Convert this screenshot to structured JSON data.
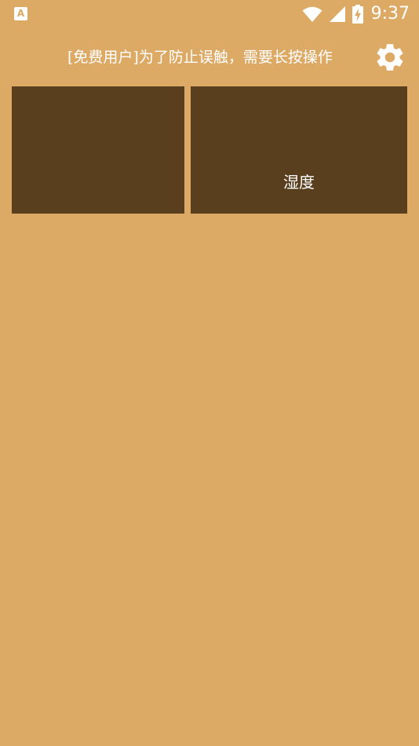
{
  "status_bar": {
    "app_badge": "A",
    "time": "9:37",
    "icons": [
      "wifi-icon",
      "cell-signal-icon",
      "battery-charging-icon"
    ]
  },
  "toolbar": {
    "notice": "[免费用户]为了防止误触，需要长按操作",
    "settings_icon": "gear-icon"
  },
  "tiles": [
    {
      "label": ""
    },
    {
      "label": "湿度"
    }
  ],
  "colors": {
    "background": "#DDAA66",
    "tile": "#5A3F1E",
    "text": "#FFFFFF"
  }
}
